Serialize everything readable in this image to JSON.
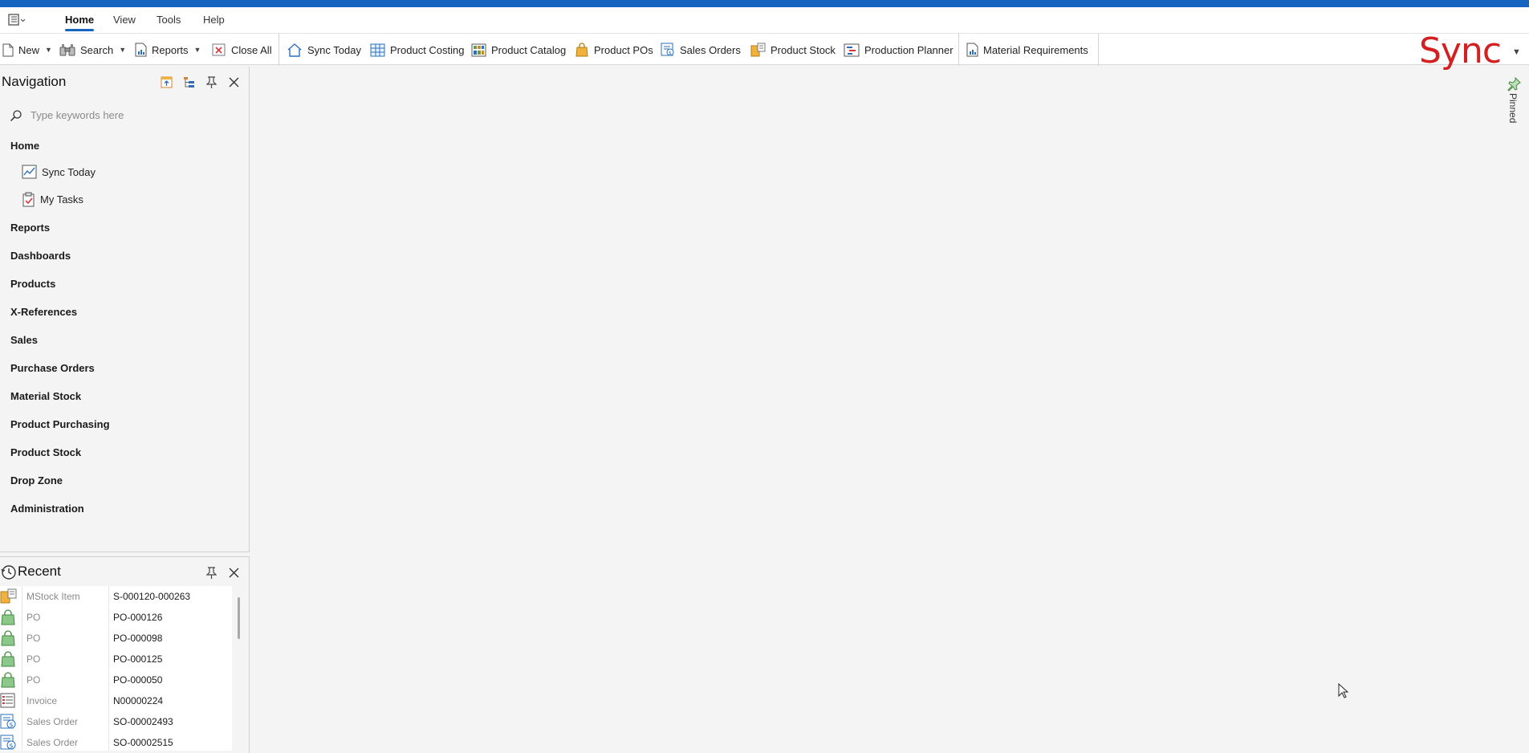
{
  "menu": {
    "tabs": [
      {
        "label": "Home",
        "active": true
      },
      {
        "label": "View",
        "active": false
      },
      {
        "label": "Tools",
        "active": false
      },
      {
        "label": "Help",
        "active": false
      }
    ]
  },
  "toolbar": {
    "new_label": "New",
    "search_label": "Search",
    "reports_label": "Reports",
    "close_all_label": "Close All",
    "sync_today_label": "Sync Today",
    "product_costing_label": "Product Costing",
    "product_catalog_label": "Product Catalog",
    "product_pos_label": "Product POs",
    "sales_orders_label": "Sales Orders",
    "product_stock_label": "Product Stock",
    "production_planner_label": "Production Planner",
    "material_requirements_label": "Material Requirements",
    "logo_text": "Sync"
  },
  "navigation": {
    "title": "Navigation",
    "search_placeholder": "Type keywords here",
    "home_label": "Home",
    "home_items": [
      {
        "label": "Sync Today",
        "icon": "chart-icon"
      },
      {
        "label": "My Tasks",
        "icon": "clipboard-check-icon"
      }
    ],
    "groups": [
      "Reports",
      "Dashboards",
      "Products",
      "X-References",
      "Sales",
      "Purchase Orders",
      "Material Stock",
      "Product Purchasing",
      "Product Stock",
      "Drop Zone",
      "Administration"
    ]
  },
  "recent": {
    "title": "Recent",
    "items": [
      {
        "type": "MStock Item",
        "id": "S-000120-000263",
        "icon": "stock-box-icon"
      },
      {
        "type": "PO",
        "id": "PO-000126",
        "icon": "shopping-bag-icon"
      },
      {
        "type": "PO",
        "id": "PO-000098",
        "icon": "shopping-bag-icon"
      },
      {
        "type": "PO",
        "id": "PO-000125",
        "icon": "shopping-bag-icon"
      },
      {
        "type": "PO",
        "id": "PO-000050",
        "icon": "shopping-bag-icon"
      },
      {
        "type": "Invoice",
        "id": "N00000224",
        "icon": "invoice-icon"
      },
      {
        "type": "Sales Order",
        "id": "SO-00002493",
        "icon": "sales-order-icon"
      },
      {
        "type": "Sales Order",
        "id": "SO-00002515",
        "icon": "sales-order-icon"
      }
    ]
  },
  "pinned": {
    "label": "Pinned"
  },
  "colors": {
    "accent": "#1565c0",
    "logo": "#d32020"
  }
}
